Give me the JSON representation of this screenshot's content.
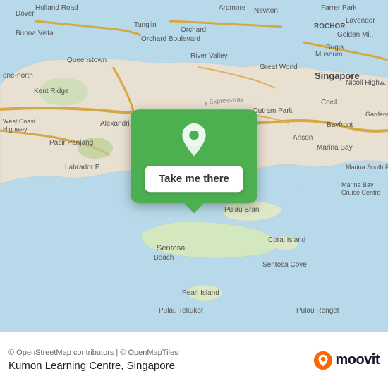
{
  "map": {
    "attribution": "© OpenStreetMap contributors | © OpenMapTiles",
    "background_water_color": "#b8d9ea",
    "background_land_color": "#e8e0d0"
  },
  "popup": {
    "button_label": "Take me there",
    "pin_color": "#ffffff"
  },
  "bottom_bar": {
    "copyright": "© OpenStreetMap contributors | © OpenMapTiles",
    "location_name": "Kumon Learning Centre, Singapore",
    "moovit_label": "moovit"
  }
}
